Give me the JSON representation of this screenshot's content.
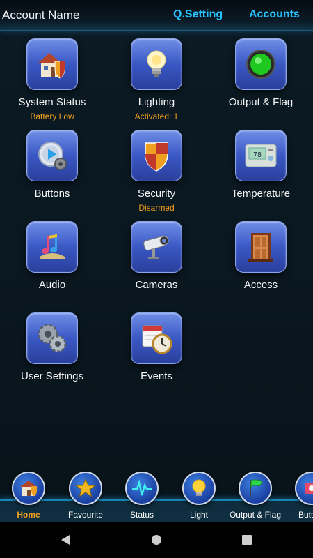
{
  "header": {
    "account_name": "Account Name",
    "qsetting": "Q.Setting",
    "accounts": "Accounts"
  },
  "tiles": [
    {
      "label": "System Status",
      "sub": "Battery Low",
      "icon": "house-shield-icon"
    },
    {
      "label": "Lighting",
      "sub": "Activated: 1",
      "icon": "light-bulb-icon"
    },
    {
      "label": "Output & Flag",
      "sub": "",
      "icon": "green-indicator-icon"
    },
    {
      "label": "Buttons",
      "sub": "",
      "icon": "play-gear-icon"
    },
    {
      "label": "Security",
      "sub": "Disarmed",
      "icon": "shield-icon"
    },
    {
      "label": "Temperature",
      "sub": "",
      "icon": "thermostat-icon"
    },
    {
      "label": "Audio",
      "sub": "",
      "icon": "music-notes-icon"
    },
    {
      "label": "Cameras",
      "sub": "",
      "icon": "security-camera-icon"
    },
    {
      "label": "Access",
      "sub": "",
      "icon": "door-icon"
    },
    {
      "label": "User Settings",
      "sub": "",
      "icon": "gears-icon"
    },
    {
      "label": "Events",
      "sub": "",
      "icon": "calendar-clock-icon"
    }
  ],
  "thermostat_display": "78",
  "nav": [
    {
      "label": "Home",
      "active": true,
      "icon": "home-icon"
    },
    {
      "label": "Favourite",
      "active": false,
      "icon": "star-icon"
    },
    {
      "label": "Status",
      "active": false,
      "icon": "pulse-icon"
    },
    {
      "label": "Light",
      "active": false,
      "icon": "bulb-icon"
    },
    {
      "label": "Output & Flag",
      "active": false,
      "icon": "flag-icon"
    },
    {
      "label": "Butt",
      "active": false,
      "icon": "buttons-icon"
    }
  ],
  "colors": {
    "accent_cyan": "#29c4ff",
    "status_orange": "#f3a01c",
    "tile_blue": "#3a58c4"
  }
}
